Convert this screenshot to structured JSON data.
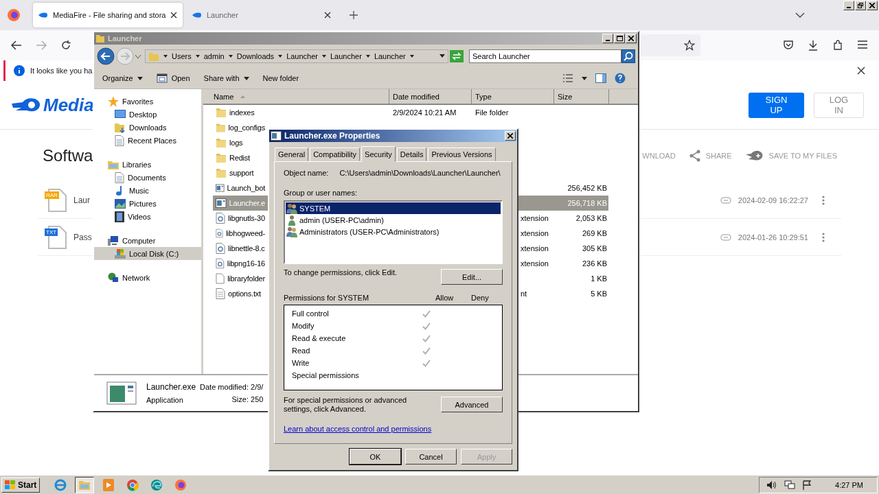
{
  "browser": {
    "tabs": [
      {
        "title": "MediaFire - File sharing and stora",
        "selected": true
      },
      {
        "title": "Launcher",
        "selected": false
      }
    ],
    "notification": "It looks like you ha",
    "site": {
      "logo": "Media",
      "buttons": [
        {
          "label": "SIGN UP",
          "kind": "primary"
        },
        {
          "label": "LOG IN",
          "kind": "outline"
        }
      ],
      "heading": "Softwa",
      "actions": [
        {
          "kind": "download",
          "label": "WNLOAD"
        },
        {
          "kind": "share",
          "label": "SHARE"
        },
        {
          "kind": "save",
          "label": "SAVE TO MY FILES"
        }
      ],
      "files": [
        {
          "badge": "RAR",
          "name": "Laur",
          "date": "2024-02-09 16:22:27"
        },
        {
          "badge": "TXT",
          "name": "Pass",
          "date": "2024-01-26 10:29:51"
        }
      ]
    }
  },
  "explorer": {
    "title": "Launcher",
    "breadcrumb": [
      "Users",
      "admin",
      "Downloads",
      "Launcher",
      "Launcher",
      "Launcher"
    ],
    "search": {
      "placeholder": "Search Launcher"
    },
    "toolbar": [
      {
        "label": "Organize",
        "kind": "menu"
      },
      {
        "label": "Open",
        "kind": "open"
      },
      {
        "label": "Share with",
        "kind": "menu"
      },
      {
        "label": "New folder",
        "kind": "plain"
      }
    ],
    "nav": [
      {
        "label": "Favorites",
        "kind": "star",
        "selected": false,
        "children": [
          {
            "label": "Desktop",
            "kind": "desktop",
            "selected": false
          },
          {
            "label": "Downloads",
            "kind": "folder",
            "selected": false
          },
          {
            "label": "Recent Places",
            "kind": "recent",
            "selected": false
          }
        ]
      },
      {
        "label": "Libraries",
        "kind": "library",
        "selected": false,
        "children": [
          {
            "label": "Documents",
            "kind": "doc",
            "selected": false
          },
          {
            "label": "Music",
            "kind": "music",
            "selected": false
          },
          {
            "label": "Pictures",
            "kind": "pictures",
            "selected": false
          },
          {
            "label": "Videos",
            "kind": "video",
            "selected": false
          }
        ]
      },
      {
        "label": "Computer",
        "kind": "computer",
        "selected": false,
        "children": [
          {
            "label": "Local Disk (C:)",
            "kind": "disk",
            "selected": true
          }
        ]
      },
      {
        "label": "Network",
        "kind": "network",
        "selected": false
      }
    ],
    "columns": [
      "Name",
      "Date modified",
      "Type",
      "Size"
    ],
    "rows": [
      {
        "name": "indexes",
        "kind": "folder",
        "date": "2/9/2024 10:21 AM",
        "type": "File folder",
        "selected": false
      },
      {
        "name": "log_configs",
        "kind": "folder",
        "selected": false
      },
      {
        "name": "logs",
        "kind": "folder",
        "selected": false
      },
      {
        "name": "Redist",
        "kind": "folder",
        "selected": false
      },
      {
        "name": "support",
        "kind": "folder",
        "selected": false
      },
      {
        "name": "Launch_bot",
        "kind": "app",
        "size": "256,452 KB",
        "selected": false
      },
      {
        "name": "Launcher.e",
        "kind": "app",
        "size": "256,718 KB",
        "selected": true
      },
      {
        "name": "libgnutls-30",
        "kind": "dll",
        "type": "xtension",
        "size": "2,053 KB",
        "selected": false
      },
      {
        "name": "libhogweed-",
        "kind": "dll",
        "type": "xtension",
        "size": "269 KB",
        "selected": false
      },
      {
        "name": "libnettle-8.c",
        "kind": "dll",
        "type": "xtension",
        "size": "305 KB",
        "selected": false
      },
      {
        "name": "libpng16-16",
        "kind": "dll",
        "type": "xtension",
        "size": "236 KB",
        "selected": false
      },
      {
        "name": "libraryfolder",
        "kind": "file",
        "size": "1 KB",
        "selected": false
      },
      {
        "name": "options.txt",
        "kind": "text",
        "type": "nt",
        "size": "5 KB",
        "selected": false
      }
    ],
    "status": {
      "name": "Launcher.exe",
      "type": "Application",
      "modified": "Date modified: 2/9/",
      "size": "Size: 250"
    }
  },
  "dialog": {
    "title": "Launcher.exe Properties",
    "tabs": [
      {
        "label": "General",
        "selected": false
      },
      {
        "label": "Compatibility",
        "selected": false
      },
      {
        "label": "Security",
        "selected": true
      },
      {
        "label": "Details",
        "selected": false
      },
      {
        "label": "Previous Versions",
        "selected": false
      }
    ],
    "object_label": "Object name:",
    "object_value": "C:\\Users\\admin\\Downloads\\Launcher\\Launcher\\",
    "groups_label": "Group or user names:",
    "users": [
      {
        "name": "SYSTEM",
        "kind": "group",
        "selected": true
      },
      {
        "name": "admin (USER-PC\\admin)",
        "kind": "user",
        "selected": false
      },
      {
        "name": "Administrators (USER-PC\\Administrators)",
        "kind": "group",
        "selected": false
      }
    ],
    "edit_hint": "To change permissions, click Edit.",
    "edit_button": "Edit...",
    "permissions_label": "Permissions for SYSTEM",
    "allow_label": "Allow",
    "deny_label": "Deny",
    "permissions": [
      {
        "name": "Full control",
        "allow": true,
        "deny": false
      },
      {
        "name": "Modify",
        "allow": true,
        "deny": false
      },
      {
        "name": "Read & execute",
        "allow": true,
        "deny": false
      },
      {
        "name": "Read",
        "allow": true,
        "deny": false
      },
      {
        "name": "Write",
        "allow": true,
        "deny": false
      },
      {
        "name": "Special permissions",
        "allow": false,
        "deny": false
      }
    ],
    "advanced_hint": "For special permissions or advanced settings, click Advanced.",
    "advanced_button": "Advanced",
    "link": "Learn about access control and permissions",
    "buttons": [
      {
        "label": "OK",
        "disabled": false,
        "default": true
      },
      {
        "label": "Cancel",
        "disabled": false,
        "default": false
      },
      {
        "label": "Apply",
        "disabled": true,
        "default": false
      }
    ]
  },
  "taskbar": {
    "start": "Start",
    "apps": [
      {
        "kind": "ie",
        "selected": false
      },
      {
        "kind": "explorer",
        "selected": true
      },
      {
        "kind": "media",
        "selected": false
      },
      {
        "kind": "chrome",
        "selected": false
      },
      {
        "kind": "edge",
        "selected": false
      },
      {
        "kind": "firefox",
        "selected": false
      }
    ],
    "time": "4:27 PM"
  }
}
